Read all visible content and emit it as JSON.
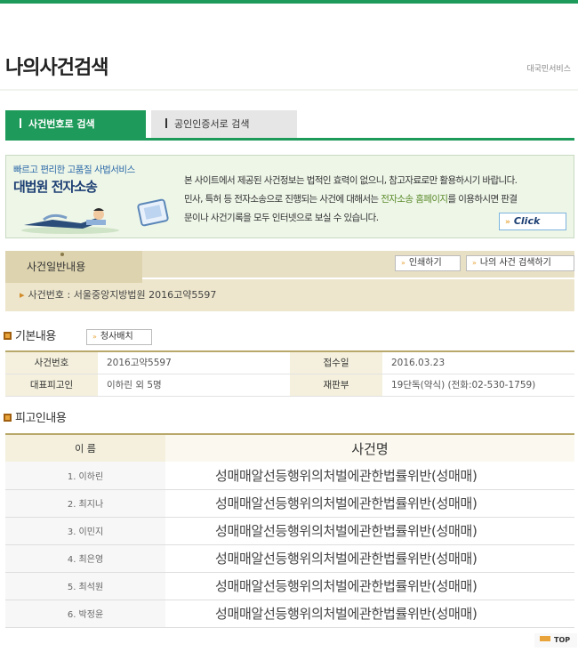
{
  "header": {
    "title": "나의사건검색",
    "breadcrumb": "대국민서비스"
  },
  "tabs": [
    {
      "label": "사건번호로 검색",
      "active": true
    },
    {
      "label": "공인인증서로 검색",
      "active": false
    }
  ],
  "banner": {
    "subtitle": "빠르고 편리한 고품질 사법서비스",
    "title": "대법원 전자소송",
    "line1": "본 사이트에서 제공된 사건정보는 법적인 효력이 없으니, 참고자료로만 활용하시기 바랍니다.",
    "line2_before": "민사, 특허 등 전자소송으로 진행되는 사건에 대해서는 ",
    "line2_link": "전자소송 홈페이지",
    "line2_after": "를 이용하시면 판결",
    "line3": "문이나 사건기록을 모두 인터넷으로 보실 수 있습니다.",
    "click_label": "Click"
  },
  "case_general": {
    "title": "사건일반내용",
    "case_number_line": "사건번호 : 서울중앙지방법원 2016고약5597",
    "print_label": "인쇄하기",
    "my_case_label": "나의 사건 검색하기"
  },
  "basic_info": {
    "title": "기본내용",
    "read_button_label": "청사배치",
    "rows": [
      [
        {
          "label": "사건번호",
          "value": "2016고약5597"
        },
        {
          "label": "접수일",
          "value": "2016.03.23"
        }
      ],
      [
        {
          "label": "대표피고인",
          "value": "이하린 외 5명"
        },
        {
          "label": "재판부",
          "value": "19단독(약식) (전화:02-530-1759)"
        }
      ]
    ]
  },
  "defendants": {
    "title": "피고인내용",
    "col_name": "이 름",
    "col_case": "사건명",
    "rows": [
      {
        "name": "1. 이하린",
        "case": "성매매알선등행위의처벌에관한법률위반(성매매)"
      },
      {
        "name": "2. 최지나",
        "case": "성매매알선등행위의처벌에관한법률위반(성매매)"
      },
      {
        "name": "3. 이민지",
        "case": "성매매알선등행위의처벌에관한법률위반(성매매)"
      },
      {
        "name": "4. 최은영",
        "case": "성매매알선등행위의처벌에관한법률위반(성매매)"
      },
      {
        "name": "5. 최석원",
        "case": "성매매알선등행위의처벌에관한법률위반(성매매)"
      },
      {
        "name": "6. 박정윤",
        "case": "성매매알선등행위의처벌에관한법률위반(성매매)"
      }
    ]
  },
  "footer": {
    "top_label": "TOP"
  },
  "colors": {
    "accent_green": "#1e9a5a",
    "section_beige": "#e8e0c4",
    "marker_orange": "#e8a43a"
  },
  "icons": [
    "double-arrow-icon",
    "section-marker-icon",
    "laptop-icon"
  ]
}
